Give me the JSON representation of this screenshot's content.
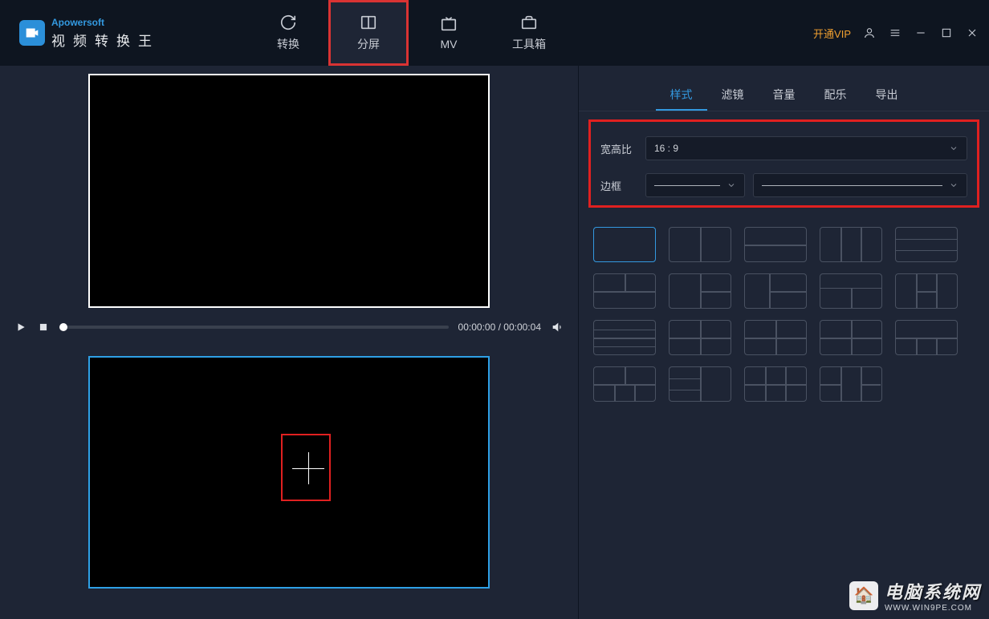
{
  "brand": "Apowersoft",
  "app_title": "视频转换王",
  "nav": {
    "convert": "转换",
    "split": "分屏",
    "mv": "MV",
    "toolbox": "工具箱"
  },
  "vip": "开通VIP",
  "player": {
    "current": "00:00:00",
    "total": "00:00:04",
    "separator": " / "
  },
  "side_tabs": {
    "style": "样式",
    "filter": "滤镜",
    "volume": "音量",
    "music": "配乐",
    "export": "导出"
  },
  "form": {
    "aspect_label": "宽高比",
    "aspect_value": "16 : 9",
    "border_label": "边框"
  },
  "watermark": {
    "cn": "电脑系统网",
    "url": "WWW.WIN9PE.COM",
    "emoji": "🏠"
  }
}
